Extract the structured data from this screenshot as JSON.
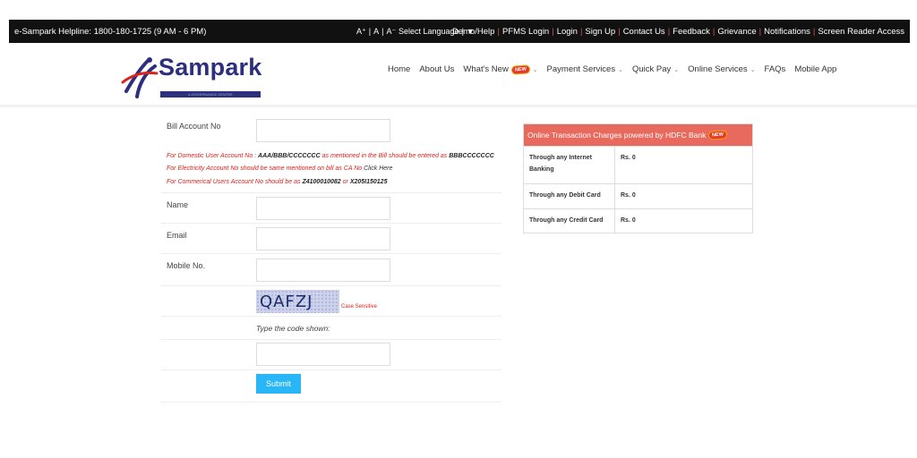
{
  "topbar": {
    "helpline": "e-Sampark Helpline: 1800-180-1725 (9 AM - 6 PM)",
    "font_sizes": [
      "A⁺",
      "A",
      "A⁻"
    ],
    "language": "Select Language",
    "language_arrow": "▼",
    "links": [
      "Demo/Help",
      "PFMS Login",
      "Login",
      "Sign Up",
      "Contact Us",
      "Feedback",
      "Grievance",
      "Notifications",
      "Screen Reader Access"
    ]
  },
  "logo": {
    "word": "Sampark",
    "tagline": "e-GOVERNANCE CENTRE"
  },
  "nav": {
    "items": [
      {
        "label": "Home",
        "dropdown": false
      },
      {
        "label": "About Us",
        "dropdown": false
      },
      {
        "label": "What's New",
        "dropdown": true,
        "badge": "NEW"
      },
      {
        "label": "Payment Services",
        "dropdown": true
      },
      {
        "label": "Quick Pay",
        "dropdown": true
      },
      {
        "label": "Online Services",
        "dropdown": true
      },
      {
        "label": "FAQs",
        "dropdown": false
      },
      {
        "label": "Mobile App",
        "dropdown": false
      }
    ],
    "chevron": "⌄"
  },
  "form": {
    "bill_account_label": "Bill Account No",
    "hints": {
      "domestic_prefix": "For Domestic User Account No : ",
      "domestic_format": "AAA/BBB/CCCCCCC",
      "domestic_middle": " as mentioned in the Bill should be entered as ",
      "domestic_example": "BBBCCCCCCC",
      "electricity_prefix": "For Electricity Account No should be same mentioned on bill as CA No ",
      "electricity_link": "Click Here",
      "commercial_prefix": "For Commerical Users Account No should be as ",
      "commercial_ex1": "Z4100010082",
      "commercial_or": " or ",
      "commercial_ex2": "X205I150125"
    },
    "name_label": "Name",
    "email_label": "Email",
    "mobile_label": "Mobile No.",
    "captcha_text": "QAFZJ",
    "case_sensitive": "Case Sensitive",
    "type_code": "Type the code shown:",
    "submit_label": "Submit"
  },
  "charges": {
    "title": "Online Transaction Charges powered by HDFC Bank",
    "badge": "NEW",
    "rows": [
      {
        "method": "Through any Internet Banking",
        "charge": "Rs. 0"
      },
      {
        "method": "Through any Debit Card",
        "charge": "Rs. 0"
      },
      {
        "method": "Through any Credit Card",
        "charge": "Rs. 0"
      }
    ]
  },
  "colors": {
    "topbar_bg": "#111111",
    "brand_blue": "#2b2f7e",
    "hint_red": "#d9231d",
    "submit_blue": "#29b6f6",
    "charges_header": "#e8695d"
  }
}
